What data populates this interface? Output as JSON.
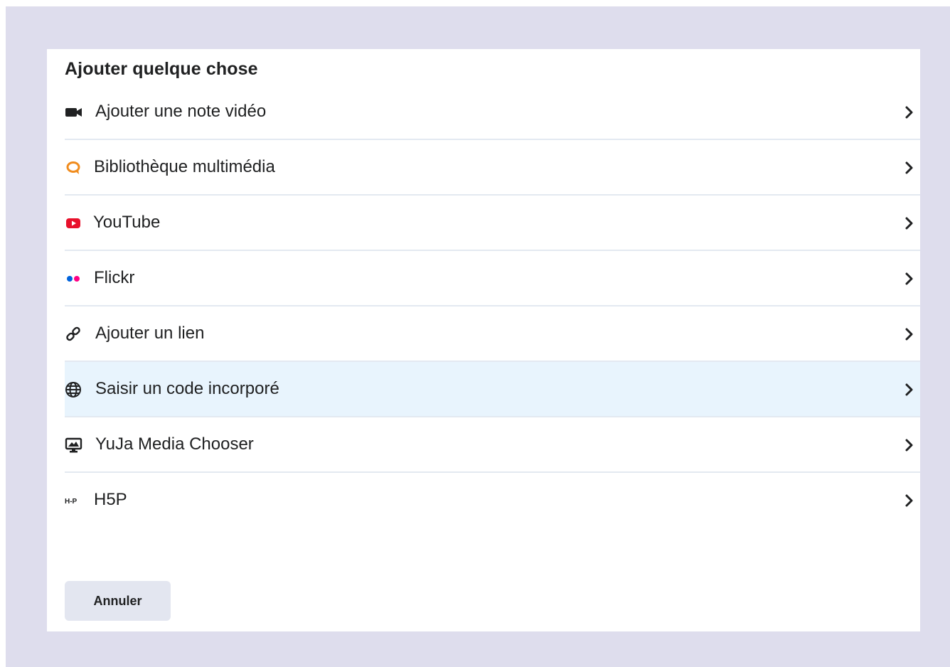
{
  "dialog": {
    "title": "Ajouter quelque chose",
    "cancel_label": "Annuler"
  },
  "menu": {
    "items": [
      {
        "label": "Ajouter une note vidéo",
        "icon": "video-camera-icon"
      },
      {
        "label": "Bibliothèque multimédia",
        "icon": "media-library-icon",
        "icon_color": "#f08c1e"
      },
      {
        "label": "YouTube",
        "icon": "youtube-icon",
        "icon_color": "#e8102b"
      },
      {
        "label": "Flickr",
        "icon": "flickr-icon",
        "icon_color_primary": "#0063dc",
        "icon_color_secondary": "#ff0084"
      },
      {
        "label": "Ajouter un lien",
        "icon": "link-icon"
      },
      {
        "label": "Saisir un code incorporé",
        "icon": "globe-icon",
        "highlighted": true
      },
      {
        "label": "YuJa Media Chooser",
        "icon": "monitor-icon"
      },
      {
        "label": "H5P",
        "icon": "h5p-icon"
      }
    ]
  },
  "colors": {
    "backdrop": "#dedded",
    "highlight": "#e8f4fd",
    "divider": "#e3e9f1",
    "cancel_button": "#e3e6f0"
  }
}
